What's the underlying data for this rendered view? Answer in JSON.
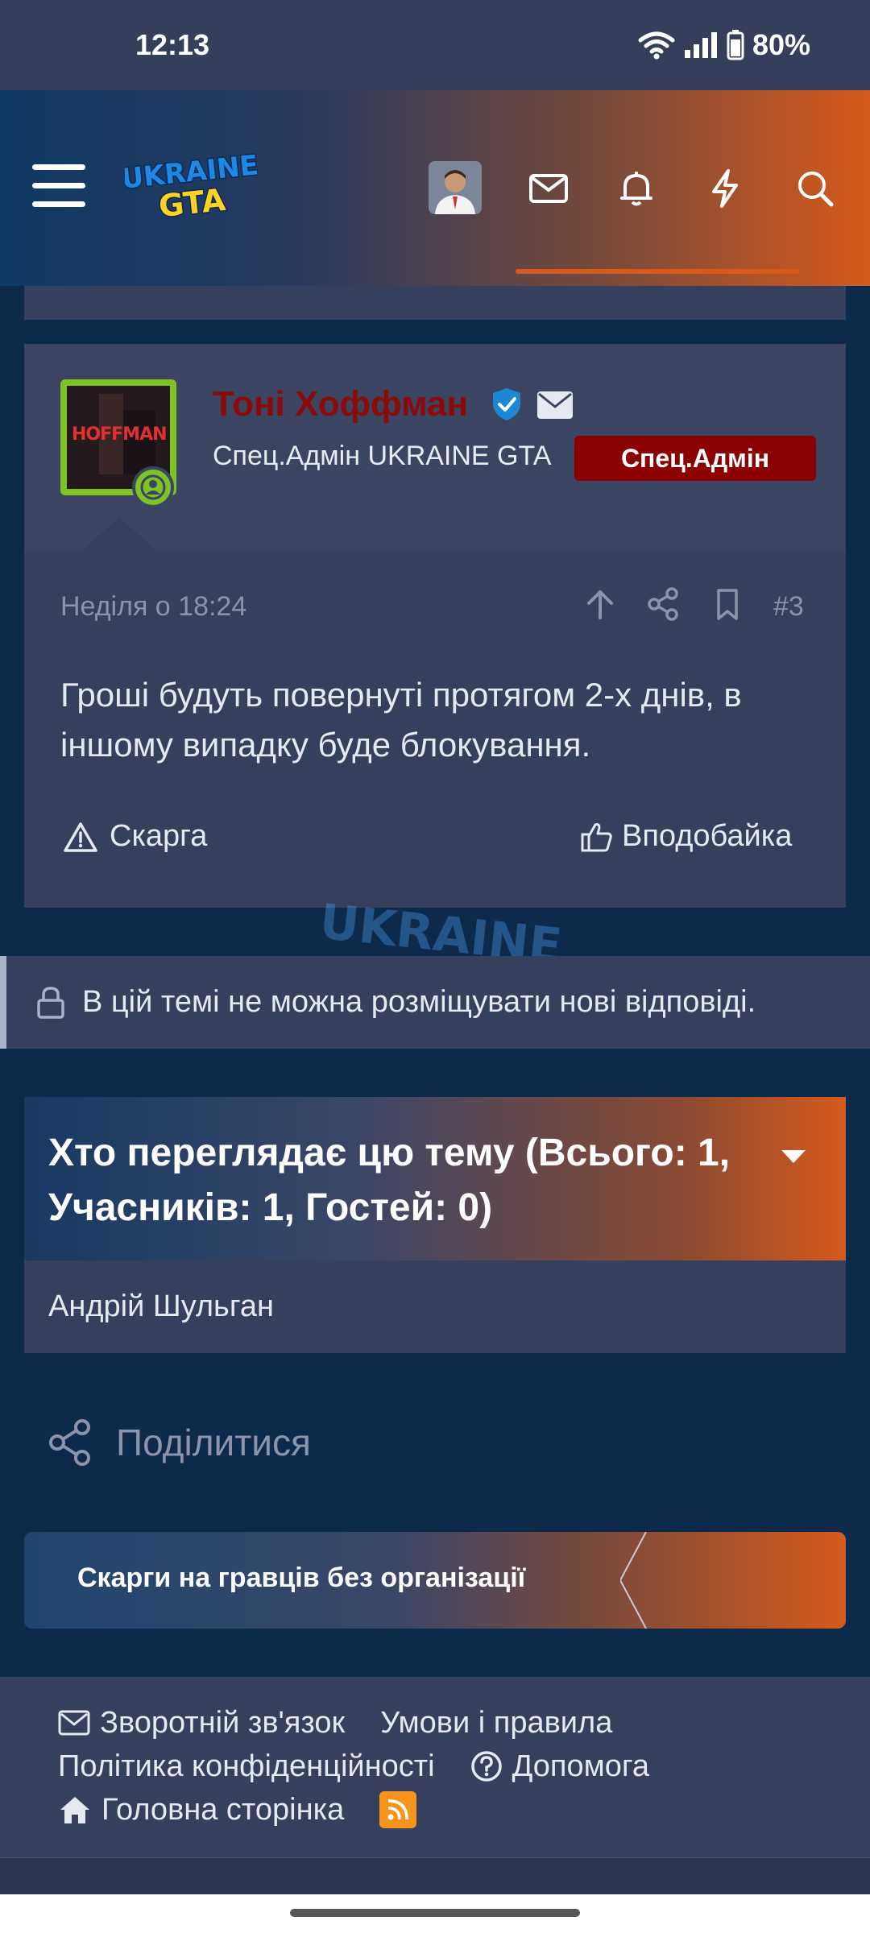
{
  "status_bar": {
    "time": "12:13",
    "battery": "80%",
    "icons": [
      "wifi-icon",
      "signal-icon",
      "battery-icon"
    ]
  },
  "header": {
    "logo_text_top": "UKRAINE",
    "logo_text_bottom": "GTA",
    "icons": [
      "menu-icon",
      "avatar",
      "mail-icon",
      "bell-icon",
      "lightning-icon",
      "search-icon"
    ]
  },
  "post": {
    "username": "Тоні Хоффман",
    "avatar_text": "HOFFMAN",
    "user_title": "Спец.Адмін UKRAINE GTA",
    "role_badge": "Спец.Адмін",
    "date": "Неділя о 18:24",
    "number": "#3",
    "body": "Гроші будуть повернуті протягом 2-х днів, в іншому випадку буде блокування.",
    "report_label": "Скарга",
    "like_label": "Вподобайка"
  },
  "locked_notice": "В цій темі не можна розміщувати нові відповіді.",
  "viewing": {
    "title": "Хто переглядає цю тему (Всього: 1, Учасників: 1, Гостей: 0)",
    "members": "Андрій Шульган"
  },
  "share_label": "Поділитися",
  "breadcrumb_label": "Скарги на гравців без організації",
  "footer": {
    "contact": "Зворотній зв'язок",
    "terms": "Умови і правила",
    "privacy": "Політика конфіденційності",
    "help": "Допомога",
    "home": "Головна сторінка"
  },
  "colors": {
    "accent_orange": "#d65a1c",
    "admin_red": "#8b0000",
    "online_green": "#7ec322",
    "panel": "#363f5c",
    "background": "#0d2a4a"
  }
}
